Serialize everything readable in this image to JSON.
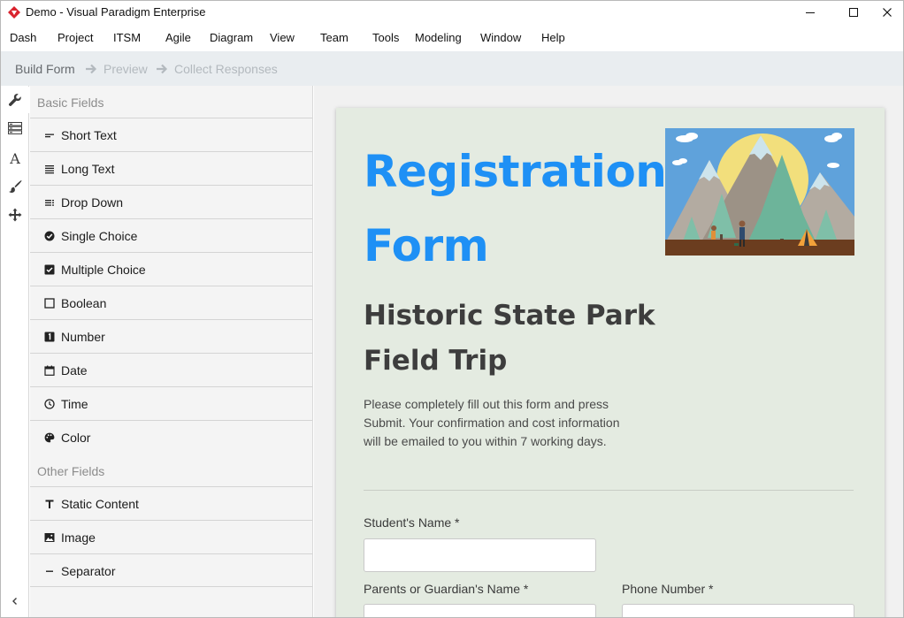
{
  "window": {
    "title": "Demo - Visual Paradigm Enterprise",
    "controls": [
      "minimize-icon",
      "maximize-icon",
      "close-icon"
    ]
  },
  "menu": [
    "Dash",
    "Project",
    "ITSM",
    "Agile",
    "Diagram",
    "View",
    "Team",
    "Tools",
    "Modeling",
    "Window",
    "Help"
  ],
  "breadcrumb": {
    "steps": [
      "Build Form",
      "Preview",
      "Collect Responses"
    ],
    "active_index": 0
  },
  "toolstrip": [
    "wrench-icon",
    "list-layout-icon",
    "font-icon",
    "paint-brush-icon",
    "move-icon"
  ],
  "palette": {
    "basic_title": "Basic Fields",
    "basic_fields": [
      {
        "label": "Short Text",
        "icon": "short-text-icon"
      },
      {
        "label": "Long Text",
        "icon": "long-text-icon"
      },
      {
        "label": "Drop Down",
        "icon": "dropdown-icon"
      },
      {
        "label": "Single Choice",
        "icon": "radio-checked-icon"
      },
      {
        "label": "Multiple Choice",
        "icon": "checkbox-checked-icon"
      },
      {
        "label": "Boolean",
        "icon": "square-icon"
      },
      {
        "label": "Number",
        "icon": "number-icon"
      },
      {
        "label": "Date",
        "icon": "calendar-icon"
      },
      {
        "label": "Time",
        "icon": "clock-icon"
      },
      {
        "label": "Color",
        "icon": "palette-icon"
      }
    ],
    "other_title": "Other Fields",
    "other_fields": [
      {
        "label": "Static Content",
        "icon": "text-t-icon"
      },
      {
        "label": "Image",
        "icon": "image-icon"
      },
      {
        "label": "Separator",
        "icon": "separator-icon"
      }
    ]
  },
  "form": {
    "title": "Registration Form",
    "subtitle": "Historic State Park Field Trip",
    "description": "Please completely fill out this form and press Submit.  Your confirmation and cost information will be emailed to you within 7 working days.",
    "fields": [
      {
        "label": "Student's Name *",
        "value": ""
      },
      {
        "label": "Parents or Guardian's Name *",
        "value": ""
      },
      {
        "label": "Phone Number *",
        "value": ""
      }
    ]
  },
  "colors": {
    "accent_blue": "#1e90f5",
    "form_background": "#e4ebe1",
    "crumb_bar": "#e9edf0"
  }
}
